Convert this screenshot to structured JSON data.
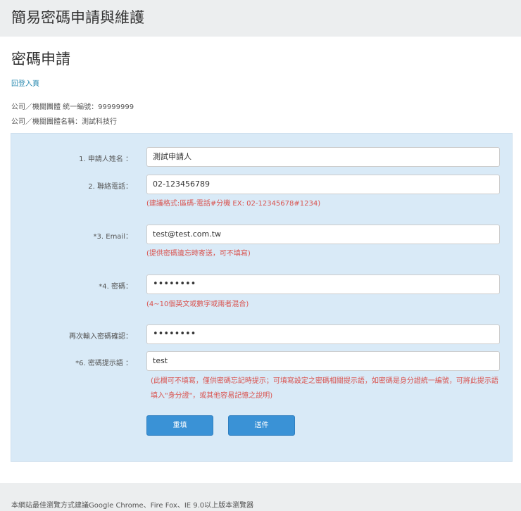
{
  "header": {
    "title": "簡易密碼申請與維護"
  },
  "page": {
    "heading": "密碼申請",
    "back_link": "回登入頁",
    "info": [
      "公司／機關團體 統一編號：99999999",
      "公司／機關團體名稱：測試科技行"
    ]
  },
  "form": {
    "fields": [
      {
        "label": "1. 申請人姓名 ：",
        "value": "測試申請人"
      },
      {
        "label": "2. 聯絡電話：",
        "value": "02-123456789",
        "hint": "(建議格式:區碼-電話#分機 EX: 02-12345678#1234)"
      },
      {
        "label": "*3. Email：",
        "value": "test@test.com.tw",
        "hint": "(提供密碼遺忘時寄送，可不填寫)"
      },
      {
        "label": "*4. 密碼：",
        "value": "••••••••",
        "hint": "(4~10個英文或數字或兩者混合)"
      },
      {
        "label": "再次輸入密碼確認：",
        "value": "••••••••"
      },
      {
        "label": "*6. 密碼提示語 ：",
        "value": "test",
        "hint": "(此欄可不填寫，僅供密碼忘記時提示；可填寫設定之密碼相關提示語，如密碼是身分證統一編號，可將此提示語填入\"身分證\"，或其他容易記憶之說明)"
      }
    ],
    "reset_label": "重填",
    "submit_label": "送件"
  },
  "footer": {
    "text": "本網站最佳瀏覽方式建議Google Chrome、Fire Fox、IE 9.0以上版本瀏覽器"
  }
}
